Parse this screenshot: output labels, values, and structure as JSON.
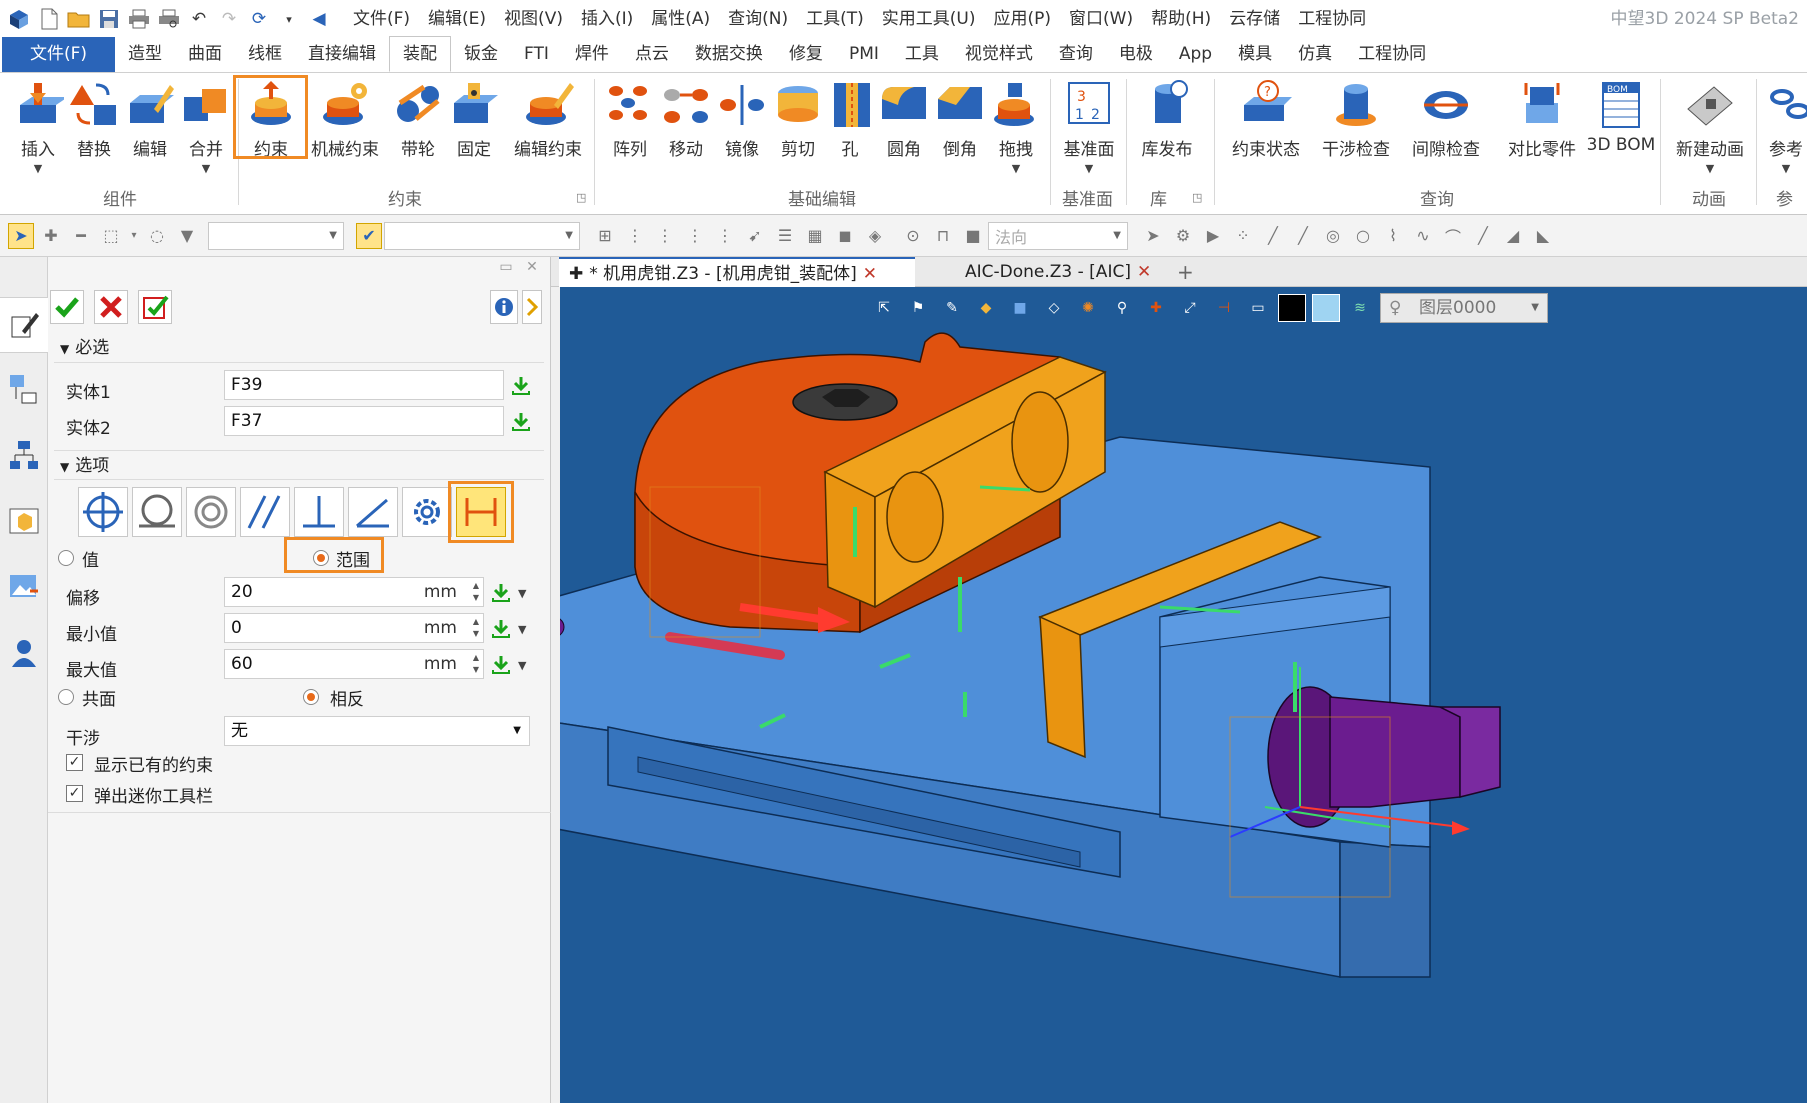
{
  "app_title": "中望3D 2024 SP Beta2",
  "menu": [
    "文件(F)",
    "编辑(E)",
    "视图(V)",
    "插入(I)",
    "属性(A)",
    "查询(N)",
    "工具(T)",
    "实用工具(U)",
    "应用(P)",
    "窗口(W)",
    "帮助(H)",
    "云存储",
    "工程协同"
  ],
  "ribbon_tabs": [
    "文件(F)",
    "造型",
    "曲面",
    "线框",
    "直接编辑",
    "装配",
    "钣金",
    "FTI",
    "焊件",
    "点云",
    "数据交换",
    "修复",
    "PMI",
    "工具",
    "视觉样式",
    "查询",
    "电极",
    "App",
    "模具",
    "仿真",
    "工程协同"
  ],
  "ribbon": {
    "buttons": [
      "插入",
      "替换",
      "编辑",
      "合并",
      "约束",
      "机械约束",
      "带轮",
      "固定",
      "编辑约束",
      "阵列",
      "移动",
      "镜像",
      "剪切",
      "孔",
      "圆角",
      "倒角",
      "拖拽",
      "基准面",
      "库发布",
      "约束状态",
      "干涉检查",
      "间隙检查",
      "对比零件",
      "3D BOM",
      "新建动画",
      "参考"
    ],
    "groups": [
      "组件",
      "约束",
      "基础编辑",
      "基准面",
      "库",
      "查询",
      "动画",
      "参考"
    ]
  },
  "toolbar": {
    "filter_value": "",
    "combo_value": "",
    "direction": "法向"
  },
  "panel": {
    "sections": {
      "required": "必选",
      "options": "选项"
    },
    "entity1_label": "实体1",
    "entity1_value": "F39",
    "entity2_label": "实体2",
    "entity2_value": "F37",
    "radio_value": "值",
    "radio_range": "范围",
    "offset_label": "偏移",
    "offset_value": "20",
    "min_label": "最小值",
    "min_value": "0",
    "max_label": "最大值",
    "max_value": "60",
    "unit": "mm",
    "coplanar": "共面",
    "opposite": "相反",
    "interference_label": "干涉",
    "interference_value": "无",
    "show_existing": "显示已有的约束",
    "popup_toolbar": "弹出迷你工具栏"
  },
  "doc_tabs": [
    "* 机用虎钳.Z3 - [机用虎钳_装配体]",
    "AIC-Done.Z3 - [AIC]"
  ],
  "layer": "图层0000",
  "colors": {
    "accent": "#2a64b8",
    "highlight": "#f08a24",
    "viewport_bg": "#1f5a97",
    "part_orange": "#e0520f",
    "part_yellow": "#f0a21c",
    "part_blue": "#4f8fd9",
    "part_purple": "#6b1c8f"
  }
}
